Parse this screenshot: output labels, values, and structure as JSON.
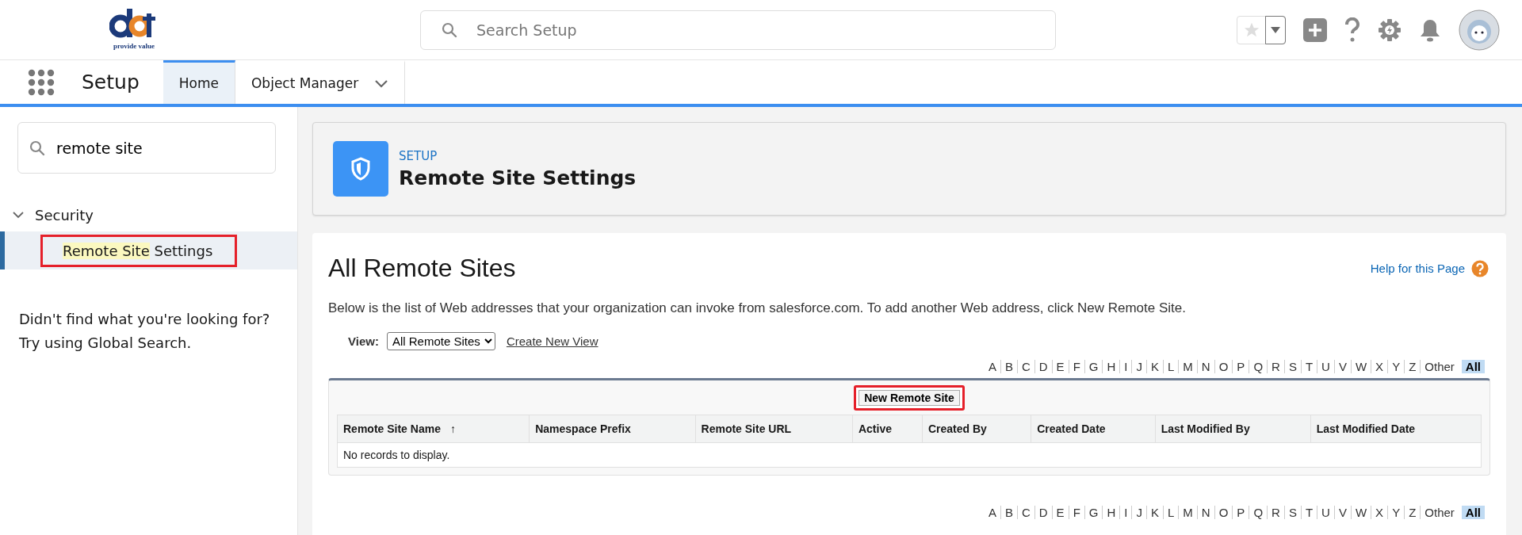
{
  "header": {
    "logo_text": "provide value",
    "search": {
      "placeholder": "Search Setup"
    }
  },
  "nav": {
    "app_name": "Setup",
    "tabs": [
      {
        "label": "Home",
        "selected": true,
        "has_menu": false
      },
      {
        "label": "Object Manager",
        "selected": false,
        "has_menu": true
      }
    ]
  },
  "sidebar": {
    "search": {
      "value": "remote site"
    },
    "tree": [
      {
        "label": "Security",
        "expanded": true,
        "children": [
          {
            "parts": [
              {
                "text": "Remote Site",
                "highlighted": true
              },
              {
                "text": " Settings",
                "highlighted": false
              }
            ],
            "selected": true,
            "annotated": true
          }
        ]
      }
    ],
    "help_text": [
      "Didn't find what you're looking for?",
      "Try using Global Search."
    ]
  },
  "page_header": {
    "eyebrow": "SETUP",
    "title": "Remote Site Settings"
  },
  "content": {
    "title": "All Remote Sites",
    "help_link": "Help for this Page",
    "description": "Below is the list of Web addresses that your organization can invoke from salesforce.com. To add another Web address, click New Remote Site.",
    "view": {
      "label": "View:",
      "value": "All Remote Sites",
      "link": "Create New View"
    },
    "letter_bar_top": [
      {
        "label": "A",
        "selected": false
      },
      {
        "label": "B",
        "selected": false
      },
      {
        "label": "C",
        "selected": false
      },
      {
        "label": "D",
        "selected": false
      },
      {
        "label": "E",
        "selected": false
      },
      {
        "label": "F",
        "selected": false
      },
      {
        "label": "G",
        "selected": false
      },
      {
        "label": "H",
        "selected": false
      },
      {
        "label": "I",
        "selected": false
      },
      {
        "label": "J",
        "selected": false
      },
      {
        "label": "K",
        "selected": false
      },
      {
        "label": "L",
        "selected": false
      },
      {
        "label": "M",
        "selected": false
      },
      {
        "label": "N",
        "selected": false
      },
      {
        "label": "O",
        "selected": false
      },
      {
        "label": "P",
        "selected": false
      },
      {
        "label": "Q",
        "selected": false
      },
      {
        "label": "R",
        "selected": false
      },
      {
        "label": "S",
        "selected": false
      },
      {
        "label": "T",
        "selected": false
      },
      {
        "label": "U",
        "selected": false
      },
      {
        "label": "V",
        "selected": false
      },
      {
        "label": "W",
        "selected": false
      },
      {
        "label": "X",
        "selected": false
      },
      {
        "label": "Y",
        "selected": false
      },
      {
        "label": "Z",
        "selected": false
      },
      {
        "label": "Other",
        "selected": false
      },
      {
        "label": "All",
        "selected": true
      }
    ],
    "table": {
      "button": {
        "label": "New Remote Site",
        "annotated": true
      },
      "columns": [
        {
          "label": "Remote Site Name",
          "sort_icon": "↑"
        },
        {
          "label": "Namespace Prefix"
        },
        {
          "label": "Remote Site URL"
        },
        {
          "label": "Active"
        },
        {
          "label": "Created By"
        },
        {
          "label": "Created Date"
        },
        {
          "label": "Last Modified By"
        },
        {
          "label": "Last Modified Date"
        }
      ],
      "empty_message": "No records to display."
    },
    "letter_bar_bottom": [
      {
        "label": "A",
        "selected": false
      },
      {
        "label": "B",
        "selected": false
      },
      {
        "label": "C",
        "selected": false
      },
      {
        "label": "D",
        "selected": false
      },
      {
        "label": "E",
        "selected": false
      },
      {
        "label": "F",
        "selected": false
      },
      {
        "label": "G",
        "selected": false
      },
      {
        "label": "H",
        "selected": false
      },
      {
        "label": "I",
        "selected": false
      },
      {
        "label": "J",
        "selected": false
      },
      {
        "label": "K",
        "selected": false
      },
      {
        "label": "L",
        "selected": false
      },
      {
        "label": "M",
        "selected": false
      },
      {
        "label": "N",
        "selected": false
      },
      {
        "label": "O",
        "selected": false
      },
      {
        "label": "P",
        "selected": false
      },
      {
        "label": "Q",
        "selected": false
      },
      {
        "label": "R",
        "selected": false
      },
      {
        "label": "S",
        "selected": false
      },
      {
        "label": "T",
        "selected": false
      },
      {
        "label": "U",
        "selected": false
      },
      {
        "label": "V",
        "selected": false
      },
      {
        "label": "W",
        "selected": false
      },
      {
        "label": "X",
        "selected": false
      },
      {
        "label": "Y",
        "selected": false
      },
      {
        "label": "Z",
        "selected": false
      },
      {
        "label": "Other",
        "selected": false
      },
      {
        "label": "All",
        "selected": true
      }
    ]
  }
}
